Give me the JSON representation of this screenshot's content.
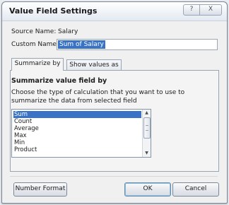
{
  "dialog": {
    "title": "Value Field Settings",
    "help_label": "?",
    "close_label": "X"
  },
  "source": {
    "label": "Source Name:",
    "value": "Salary"
  },
  "custom": {
    "label": "Custom Name:",
    "value": "Sum of Salary"
  },
  "tabs": [
    {
      "label": "Summarize by"
    },
    {
      "label": "Show values as"
    }
  ],
  "summarize": {
    "heading": "Summarize value field by",
    "description": "Choose the type of calculation that you want to use to summarize the data from selected field",
    "items": [
      "Sum",
      "Count",
      "Average",
      "Max",
      "Min",
      "Product"
    ],
    "selected": "Sum"
  },
  "buttons": {
    "number_format": "Number Format",
    "ok": "OK",
    "cancel": "Cancel"
  }
}
